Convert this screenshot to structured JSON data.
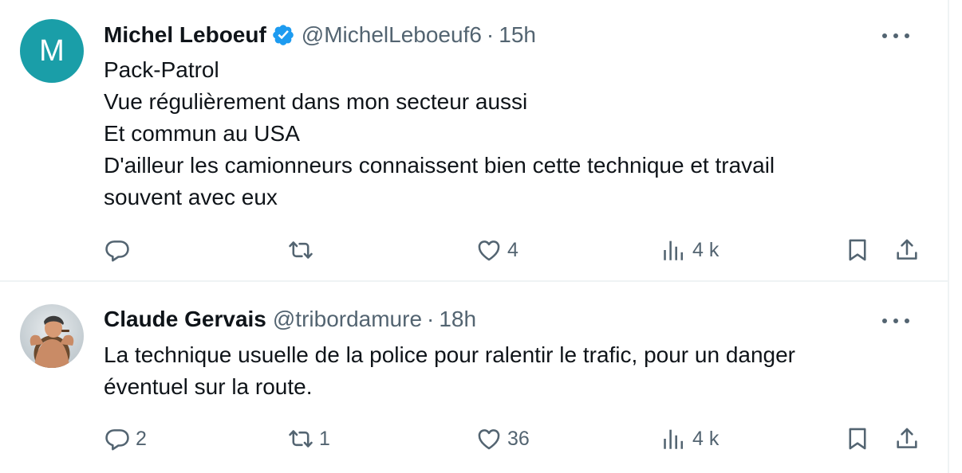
{
  "tweets": [
    {
      "avatar_letter": "M",
      "author_name": "Michel Leboeuf",
      "verified": true,
      "handle": "@MichelLeboeuf6",
      "separator": "·",
      "time": "15h",
      "lines": [
        "Pack-Patrol",
        "Vue régulièrement dans mon secteur aussi",
        "Et commun au USA",
        "D'ailleur les camionneurs connaissent bien cette technique et travail",
        "souvent avec eux"
      ],
      "reply_count": "",
      "retweet_count": "",
      "like_count": "4",
      "view_count": "4 k"
    },
    {
      "author_name": "Claude Gervais",
      "verified": false,
      "handle": "@tribordamure",
      "separator": "·",
      "time": "18h",
      "lines": [
        "La technique usuelle de la police pour ralentir le trafic, pour un danger",
        "éventuel sur la route."
      ],
      "reply_count": "2",
      "retweet_count": "1",
      "like_count": "36",
      "view_count": "4 k"
    }
  ],
  "icons": {
    "reply": "reply-icon",
    "retweet": "retweet-icon",
    "like": "heart-icon",
    "views": "views-icon",
    "bookmark": "bookmark-icon",
    "share": "share-icon",
    "more": "more-icon",
    "verified": "verified-badge-icon"
  },
  "colors": {
    "text_primary": "#0f1419",
    "text_secondary": "#536471",
    "verified_blue": "#1d9bf0",
    "avatar_teal": "#1a9ea8",
    "divider": "#eff3f4"
  }
}
